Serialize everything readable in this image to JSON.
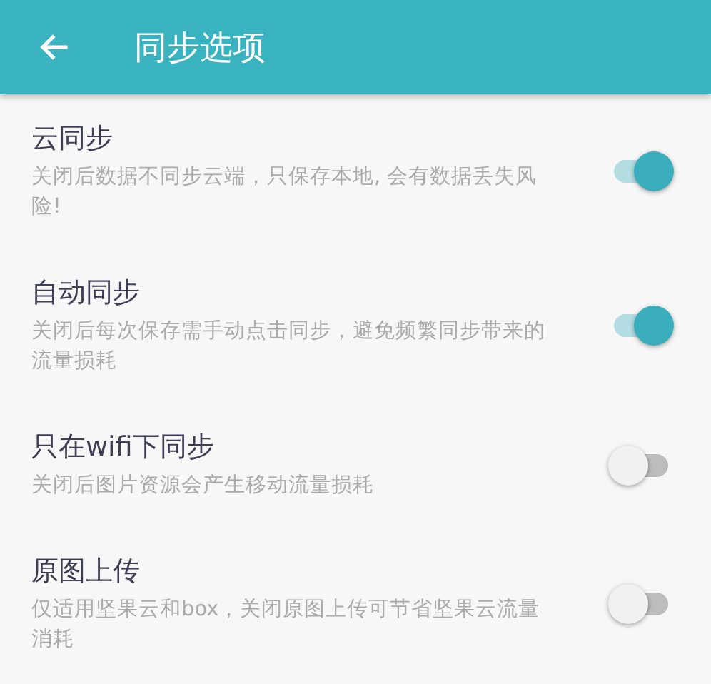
{
  "app_bar": {
    "title": "同步选项"
  },
  "settings": [
    {
      "title": "云同步",
      "description": "关闭后数据不同步云端，只保存本地, 会有数据丢失风险!",
      "on": true
    },
    {
      "title": "自动同步",
      "description": "关闭后每次保存需手动点击同步，避免频繁同步带来的流量损耗",
      "on": true
    },
    {
      "title": "只在wifi下同步",
      "description": "关闭后图片资源会产生移动流量损耗",
      "on": false
    },
    {
      "title": "原图上传",
      "description": "仅适用坚果云和box，关闭原图上传可节省坚果云流量消耗",
      "on": false
    }
  ]
}
